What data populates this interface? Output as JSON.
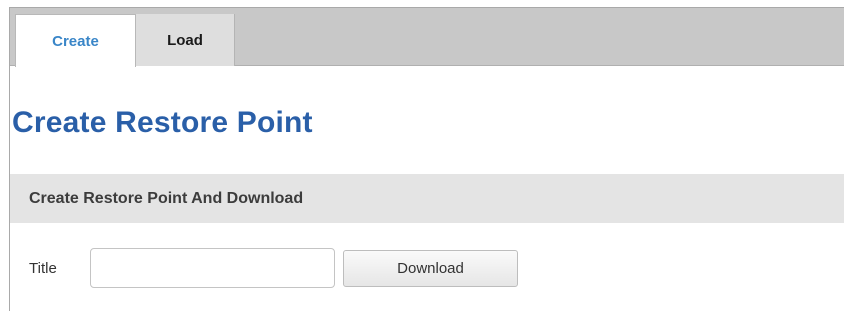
{
  "tabs": [
    {
      "label": "Create",
      "active": true
    },
    {
      "label": "Load",
      "active": false
    }
  ],
  "page": {
    "title": "Create Restore Point"
  },
  "section": {
    "header": "Create Restore Point And Download",
    "form": {
      "title_label": "Title",
      "title_value": "",
      "title_placeholder": "",
      "download_label": "Download"
    }
  },
  "colors": {
    "active_tab_text": "#3a86c8",
    "page_title": "#2a5fa8",
    "tab_bar_bg": "#c8c8c8",
    "section_header_bg": "#e4e4e4"
  }
}
